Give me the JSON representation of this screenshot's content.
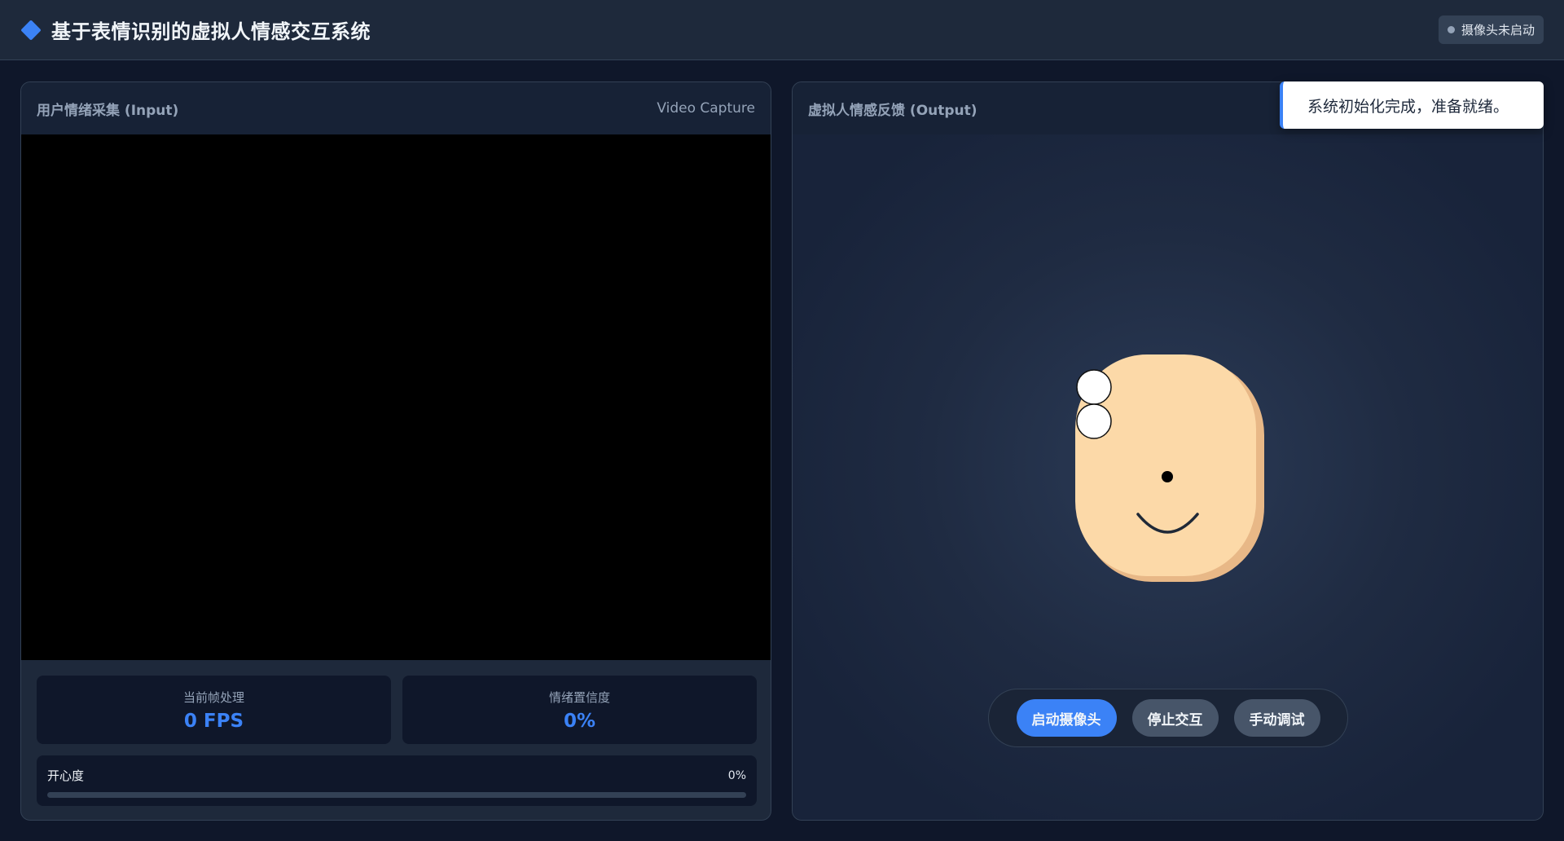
{
  "header": {
    "title": "基于表情识别的虚拟人情感交互系统",
    "camera_status": "摄像头未启动"
  },
  "input_panel": {
    "title": "用户情绪采集 (Input)",
    "subtitle": "Video Capture",
    "stats": [
      {
        "label": "当前帧处理",
        "value": "0 FPS"
      },
      {
        "label": "情绪置信度",
        "value": "0%"
      }
    ],
    "happiness": {
      "label": "开心度",
      "value": "0%",
      "level": 0
    }
  },
  "output_panel": {
    "title": "虚拟人情感反馈 (Output)",
    "buttons": {
      "start_camera": "启动摄像头",
      "stop_interaction": "停止交互",
      "manual_debug": "手动调试"
    }
  },
  "toast": {
    "message": "系统初始化完成，准备就绪。"
  },
  "colors": {
    "accent": "#3b82f6",
    "background": "#0f172a",
    "panel": "#1e293b",
    "face_skin": "#fcd9a8",
    "face_shadow": "#e8b887"
  },
  "icons": {
    "brand": "diamond-icon",
    "status": "status-dot-icon"
  }
}
